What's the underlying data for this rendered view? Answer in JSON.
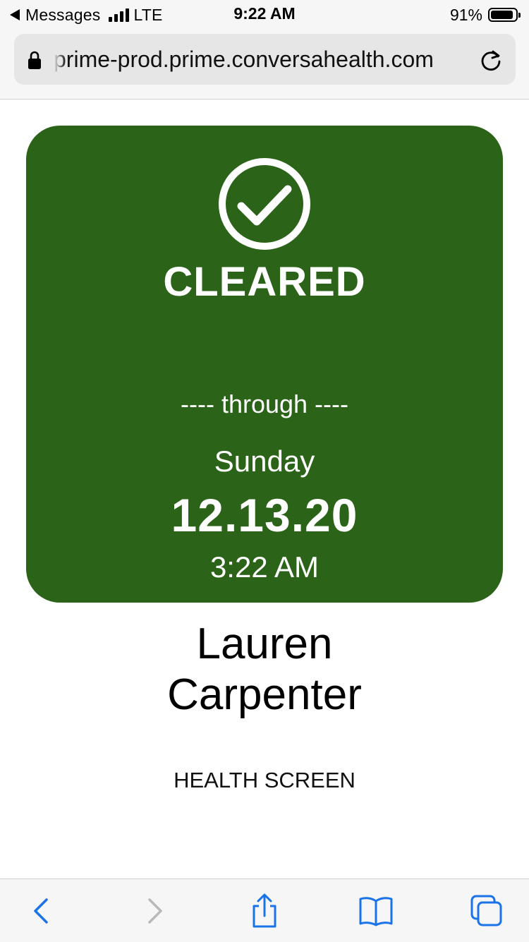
{
  "status_bar": {
    "back_app": "Messages",
    "network": "LTE",
    "time": "9:22 AM",
    "battery_percent_text": "91%",
    "battery_level": 0.91
  },
  "browser": {
    "url": "prime-prod.prime.conversahealth.com",
    "icons": [
      "lock-icon",
      "reload-icon"
    ]
  },
  "card": {
    "icon": "check-circle-icon",
    "status": "CLEARED",
    "through": "---- through ----",
    "day": "Sunday",
    "date": "12.13.20",
    "time": "3:22 AM",
    "color": "#2b6418"
  },
  "person": {
    "first_name": "Lauren",
    "last_name": "Carpenter"
  },
  "screen_type": "HEALTH SCREEN",
  "toolbar": {
    "icons": [
      "back-icon",
      "forward-icon",
      "share-icon",
      "bookmarks-icon",
      "tabs-icon"
    ],
    "accent_color": "#1a73e8"
  }
}
